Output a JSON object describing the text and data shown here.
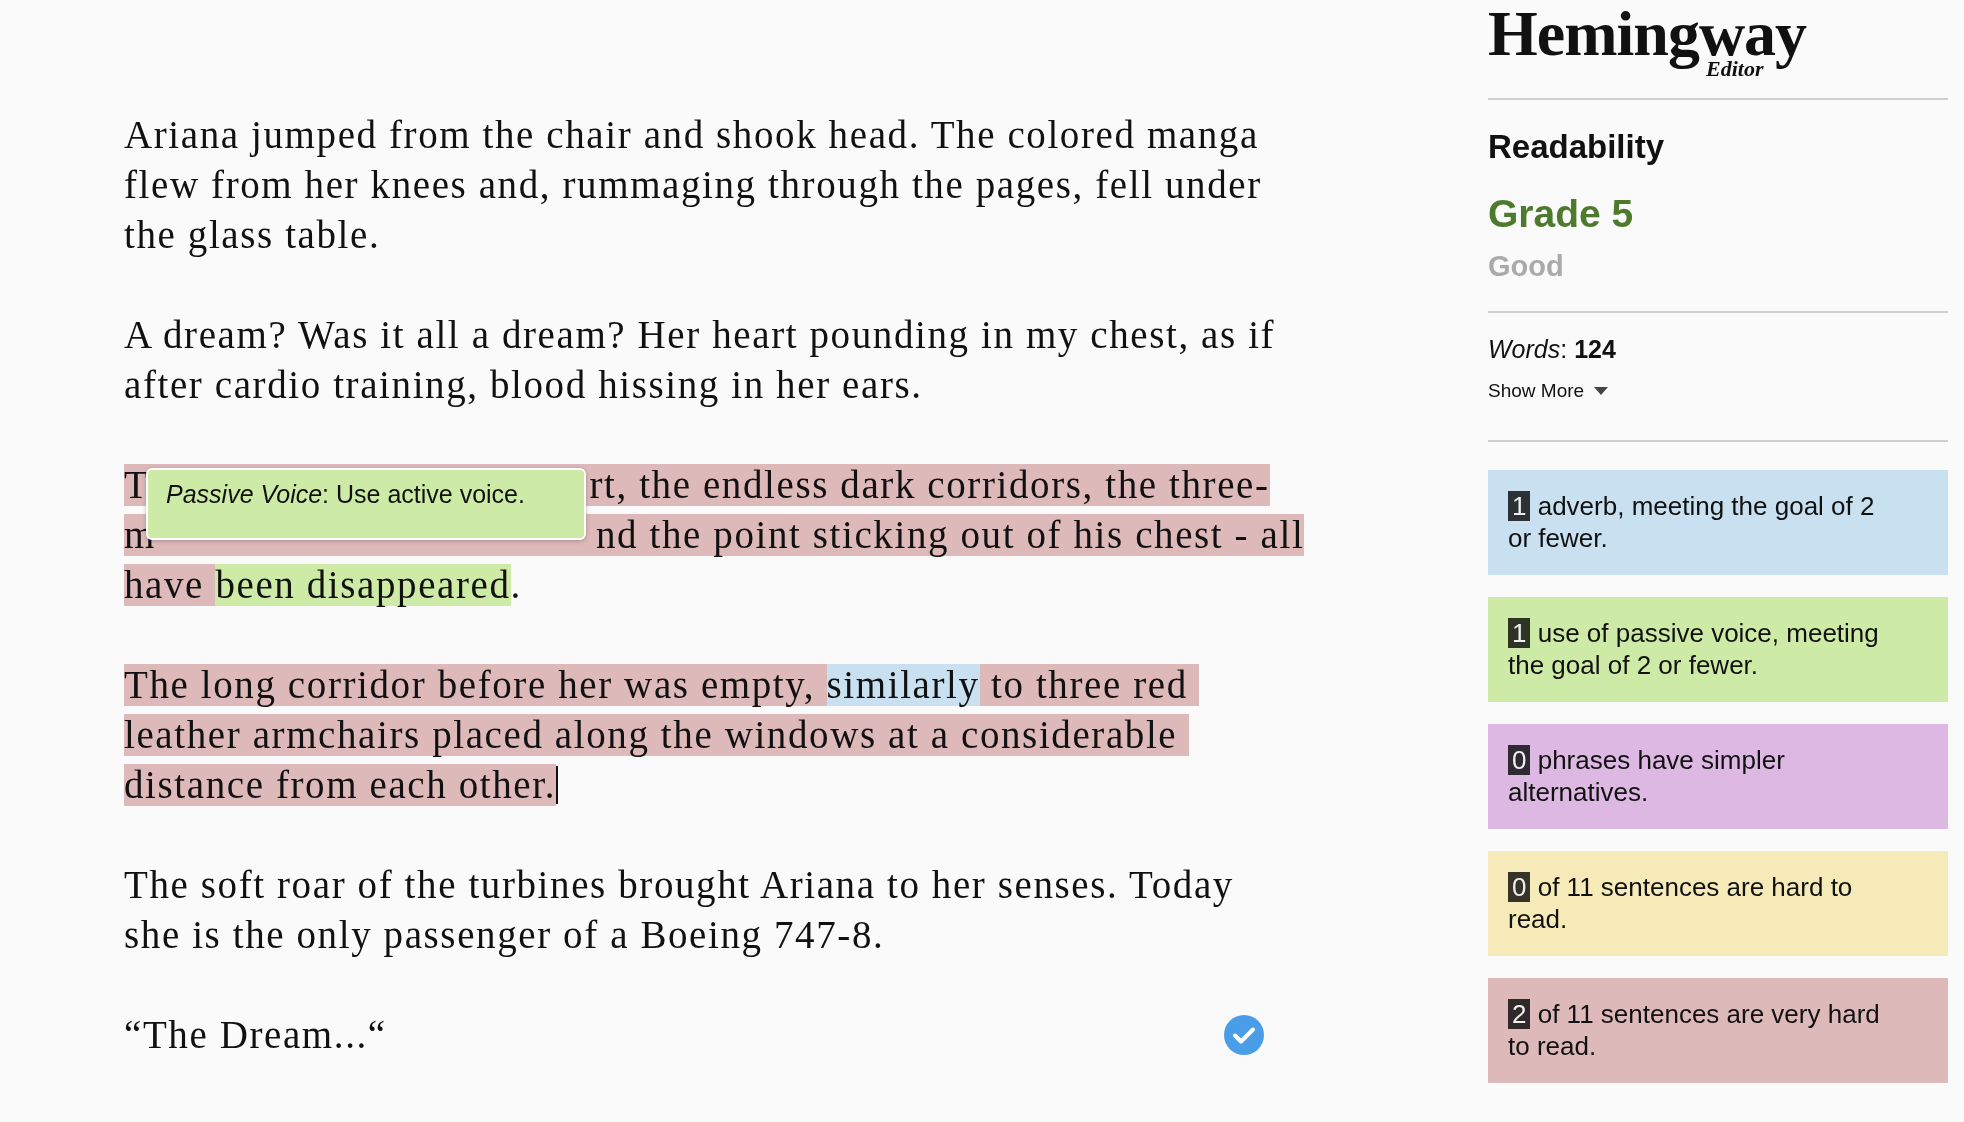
{
  "editor": {
    "paragraphs": [
      {
        "lines": [
          [
            {
              "text": "Ariana jumped from the chair and shook head. The colored manga"
            }
          ],
          [
            {
              "text": "flew from her knees and, rummaging through the pages, fell under"
            }
          ],
          [
            {
              "text": "the glass table."
            }
          ]
        ]
      },
      {
        "lines": [
          [
            {
              "text": "A dream? Was it all a dream? Her heart pounding in my chest, as if"
            }
          ],
          [
            {
              "text": "after cardio training, blood hissing in her ears."
            }
          ]
        ]
      },
      {
        "lines": [
          [
            {
              "text": "T",
              "color": "#deb9b9"
            },
            {
              "kind": "covered",
              "color": "#deb9b9"
            },
            {
              "text": "rt, the endless dark corridors, the three-",
              "color": "#deb9b9"
            }
          ],
          [
            {
              "text": "m",
              "color": "#deb9b9"
            },
            {
              "kind": "covered",
              "color": "#deb9b9"
            },
            {
              "text": "nd the point sticking out of his chest - all",
              "color": "#deb9b9"
            }
          ],
          [
            {
              "text": "have ",
              "color": "#deb9b9"
            },
            {
              "text": "been disappeared",
              "color": "#cdeaa6"
            },
            {
              "text": "."
            }
          ]
        ],
        "tooltip": "*Passive Voice*: Use active voice."
      },
      {
        "lines": [
          [
            {
              "text": "The long corridor before her was empty, ",
              "color": "#deb9b9"
            },
            {
              "text": "similarly",
              "color": "#c9e0f0"
            },
            {
              "text": " to three red ",
              "color": "#deb9b9"
            }
          ],
          [
            {
              "text": "leather armchairs placed along the windows at a considerable ",
              "color": "#deb9b9"
            }
          ],
          [
            {
              "text": "distance from each other.",
              "color": "#deb9b9"
            }
          ]
        ],
        "cursor": true
      },
      {
        "lines": [
          [
            {
              "text": "The soft roar of the turbines brought Ariana to her senses. Today"
            }
          ],
          [
            {
              "text": "she is the only passenger of a Boeing 747-8."
            }
          ]
        ]
      },
      {
        "lines": [
          [
            {
              "text": "“The Dream...“"
            }
          ]
        ],
        "check": true
      }
    ]
  },
  "sidebar": {
    "logo": {
      "title": "Hemingway",
      "subtitle": "Editor"
    },
    "heading": "Readability",
    "grade": "Grade 5",
    "grade_label": "Good",
    "words": "*Words*: **124**",
    "show_more": "Show More",
    "cards": [
      {
        "count": "1",
        "text": "adverb, meeting the goal of 2 or fewer.",
        "color": "#c9e0f0"
      },
      {
        "count": "1",
        "text": "use of passive voice, meeting the goal of 2 or fewer.",
        "color": "#cdeaa6"
      },
      {
        "count": "0",
        "text": "phrases have simpler alternatives.",
        "color": "#dcb8e3"
      },
      {
        "count": "0",
        "text": "of 11 sentences are hard to read.",
        "color": "#f6eab9"
      },
      {
        "count": "2",
        "text": "of 11 sentences are very hard to read.",
        "color": "#deb9b9"
      }
    ]
  }
}
